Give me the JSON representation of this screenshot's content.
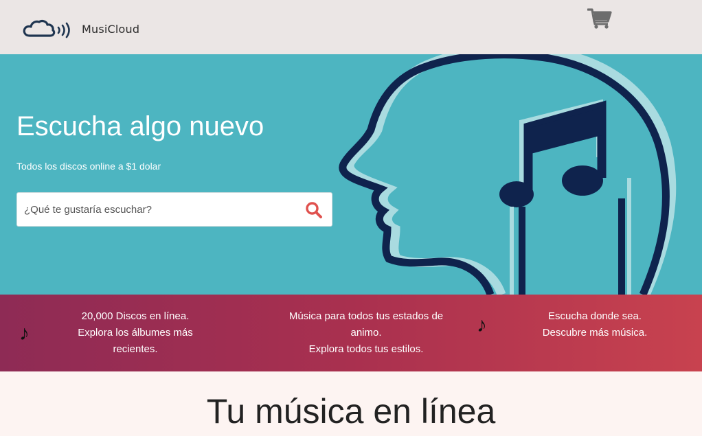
{
  "header": {
    "brand": "MusiCloud",
    "logo_icon": "cloud-sound-icon",
    "cart_icon": "shopping-cart-icon"
  },
  "hero": {
    "title": "Escucha algo nuevo",
    "subtitle": "Todos los discos online a $1 dolar",
    "search": {
      "placeholder": "¿Qué te gustaría escuchar?",
      "value": "",
      "icon": "search-icon"
    },
    "illustration": "head-music-note-icon",
    "background_color": "#4db5c1"
  },
  "features": {
    "icon": "music-note-icon",
    "items": [
      {
        "line1": "20,000 Discos en línea.",
        "line2": "Explora los álbumes más",
        "line3": "recientes."
      },
      {
        "line1": "Música para todos tus estados de",
        "line2": "animo.",
        "line3": "Explora todos tus estilos."
      },
      {
        "line1": "Escucha donde sea.",
        "line2": "Descubre más música.",
        "line3": ""
      }
    ]
  },
  "section": {
    "title": "Tu música en línea"
  },
  "colors": {
    "header_bg": "#ebe6e5",
    "band_start": "#8e2b55",
    "band_end": "#c8424f",
    "search_icon": "#e0514e"
  }
}
